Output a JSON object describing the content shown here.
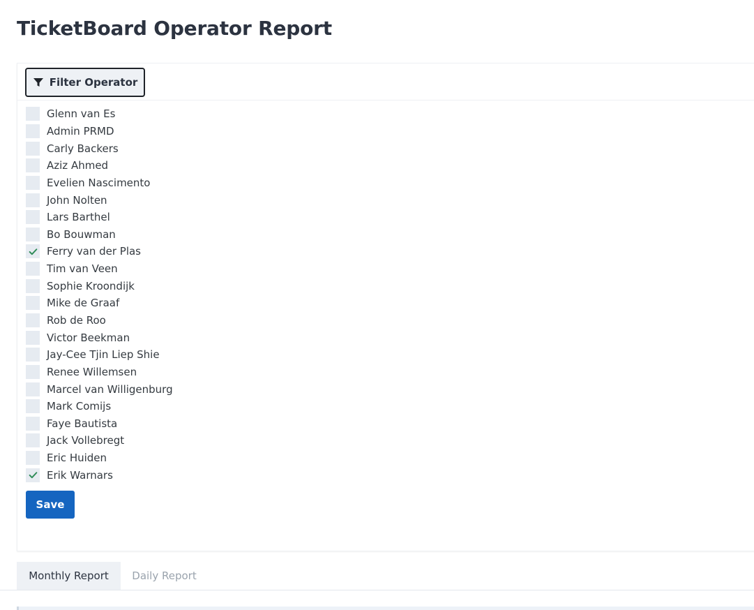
{
  "page": {
    "title": "TicketBoard Operator Report"
  },
  "filter": {
    "button_label": "Filter Operator",
    "icon": "filter-icon"
  },
  "operators": [
    {
      "name": "Glenn van Es",
      "checked": false
    },
    {
      "name": "Admin PRMD",
      "checked": false
    },
    {
      "name": "Carly Backers",
      "checked": false
    },
    {
      "name": "Aziz Ahmed",
      "checked": false
    },
    {
      "name": "Evelien Nascimento",
      "checked": false
    },
    {
      "name": "John Nolten",
      "checked": false
    },
    {
      "name": "Lars Barthel",
      "checked": false
    },
    {
      "name": "Bo Bouwman",
      "checked": false
    },
    {
      "name": "Ferry van der Plas",
      "checked": true
    },
    {
      "name": "Tim van Veen",
      "checked": false
    },
    {
      "name": "Sophie Kroondijk",
      "checked": false
    },
    {
      "name": "Mike de Graaf",
      "checked": false
    },
    {
      "name": "Rob de Roo",
      "checked": false
    },
    {
      "name": "Victor Beekman",
      "checked": false
    },
    {
      "name": "Jay-Cee Tjin Liep Shie",
      "checked": false
    },
    {
      "name": "Renee Willemsen",
      "checked": false
    },
    {
      "name": "Marcel van Willigenburg",
      "checked": false
    },
    {
      "name": "Mark Comijs",
      "checked": false
    },
    {
      "name": "Faye Bautista",
      "checked": false
    },
    {
      "name": "Jack Vollebregt",
      "checked": false
    },
    {
      "name": "Eric Huiden",
      "checked": false
    },
    {
      "name": "Erik Warnars",
      "checked": true
    }
  ],
  "actions": {
    "save_label": "Save"
  },
  "tabs": [
    {
      "label": "Monthly Report",
      "active": true
    },
    {
      "label": "Daily Report",
      "active": false
    }
  ],
  "colors": {
    "primary": "#1565c0",
    "checkmark": "#2e8b57",
    "title": "#2c3340",
    "inactive_tab": "#9aa3ad"
  }
}
